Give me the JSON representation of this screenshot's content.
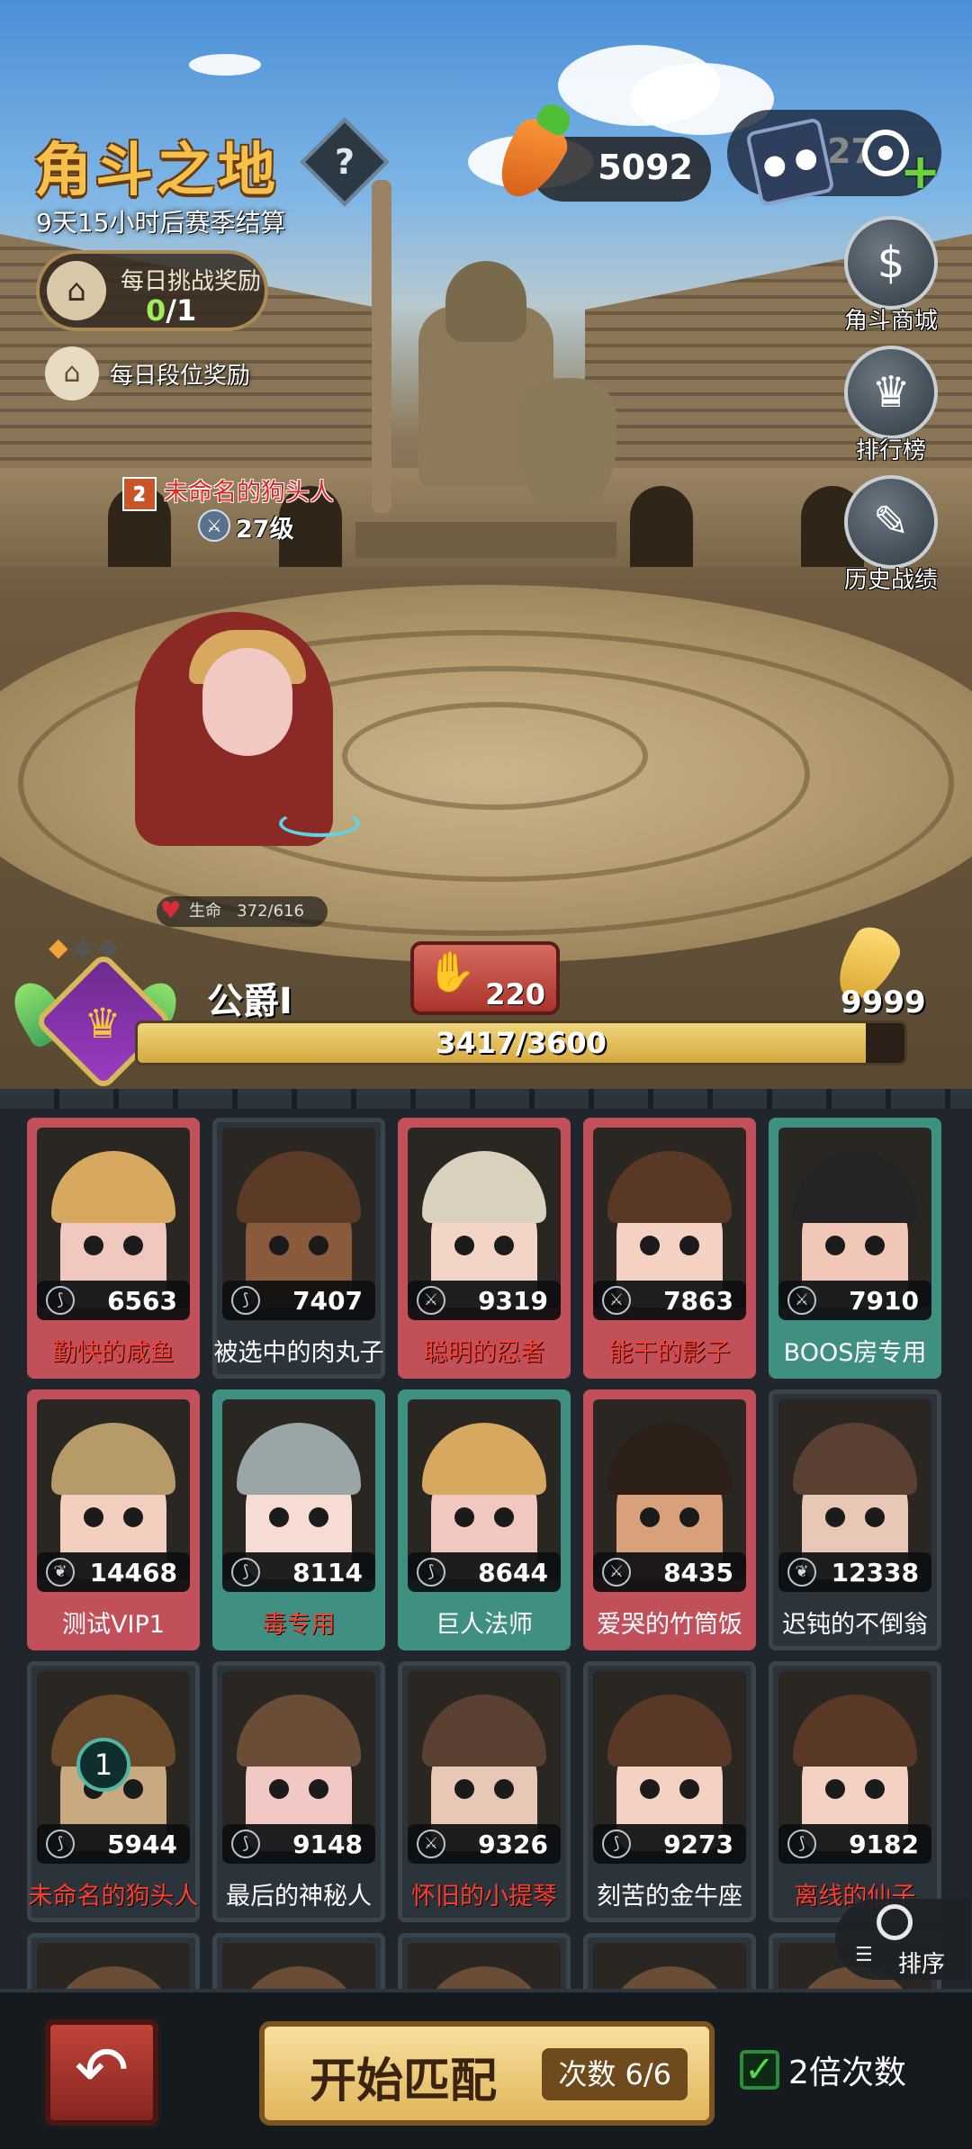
{
  "header": {
    "title": "角斗之地",
    "help": "?",
    "season_text": "9天15小时后赛季结算",
    "daily_challenge": {
      "label": "每日挑战奖励",
      "current": "0",
      "total": "/1"
    },
    "daily_rank_reward": "每日段位奖励"
  },
  "resources": {
    "carrot": "5092",
    "ticket": "27"
  },
  "side_buttons": [
    {
      "id": "shop",
      "label": "角斗商城",
      "icon": "money-bag-icon"
    },
    {
      "id": "rank",
      "label": "排行榜",
      "icon": "trophy-icon"
    },
    {
      "id": "history",
      "label": "历史战绩",
      "icon": "scroll-icon"
    }
  ],
  "opponent": {
    "name": "未命名的狗头人",
    "level": "27级"
  },
  "player": {
    "hp_label": "生命",
    "hp": "372/616",
    "rank_name": "公爵I",
    "score": "220",
    "gold_carrot": "9999",
    "xp": "3417/3600",
    "xp_fraction": 0.949
  },
  "roster": [
    {
      "name": "勤快的咸鱼",
      "power": "6563",
      "frame": "pink",
      "red": true,
      "skin": "#f0c8c0",
      "hair": "#d6a860",
      "icon": "claw"
    },
    {
      "name": "被选中的肉丸子",
      "power": "7407",
      "frame": "dark",
      "red": false,
      "skin": "#8a5a3c",
      "hair": "#5b3a26",
      "icon": "claw"
    },
    {
      "name": "聪明的忍者",
      "power": "9319",
      "frame": "pink",
      "red": true,
      "skin": "#f3d5c8",
      "hair": "#d9d1bd",
      "icon": "sword"
    },
    {
      "name": "能干的影子",
      "power": "7863",
      "frame": "pink",
      "red": true,
      "skin": "#f4d1c2",
      "hair": "#5a3826",
      "icon": "sword"
    },
    {
      "name": "BOOS房专用",
      "power": "7910",
      "frame": "teal",
      "red": false,
      "skin": "#f1c7b8",
      "hair": "#242424",
      "icon": "sword"
    },
    {
      "name": "测试VIP1",
      "power": "14468",
      "frame": "pink",
      "red": false,
      "skin": "#f3cfbf",
      "hair": "#b79a6a",
      "icon": "leaf"
    },
    {
      "name": "毒专用",
      "power": "8114",
      "frame": "teal",
      "red": true,
      "skin": "#f6dcd3",
      "hair": "#9aa6a6",
      "icon": "claw"
    },
    {
      "name": "巨人法师",
      "power": "8644",
      "frame": "teal",
      "red": false,
      "skin": "#f0c8c0",
      "hair": "#d6a860",
      "icon": "claw"
    },
    {
      "name": "爱哭的竹筒饭",
      "power": "8435",
      "frame": "pink",
      "red": false,
      "skin": "#d9a07c",
      "hair": "#2c1f18",
      "icon": "sword"
    },
    {
      "name": "迟钝的不倒翁",
      "power": "12338",
      "frame": "dark",
      "red": false,
      "skin": "#e8c7b6",
      "hair": "#5a4032",
      "icon": "leaf"
    },
    {
      "name": "未命名的狗头人",
      "power": "5944",
      "frame": "dark",
      "red": true,
      "skin": "#c8a980",
      "hair": "#6b4a2c",
      "icon": "claw",
      "badge": "1"
    },
    {
      "name": "最后的神秘人",
      "power": "9148",
      "frame": "dark",
      "red": false,
      "skin": "#f1c8c4",
      "hair": "#6a4d36",
      "icon": "claw"
    },
    {
      "name": "怀旧的小提琴",
      "power": "9326",
      "frame": "dark",
      "red": true,
      "skin": "#e8c7b6",
      "hair": "#5a4032",
      "icon": "sword"
    },
    {
      "name": "刻苦的金牛座",
      "power": "9273",
      "frame": "dark",
      "red": false,
      "skin": "#f4d1c2",
      "hair": "#5a3826",
      "icon": "claw"
    },
    {
      "name": "离线的仙子",
      "power": "9182",
      "frame": "dark",
      "red": true,
      "skin": "#f4d1c2",
      "hair": "#5a3826",
      "icon": "claw"
    }
  ],
  "sort_label": "排序",
  "bottom": {
    "start_label": "开始匹配",
    "count_label": "次数 6/6",
    "double_label": "2倍次数",
    "double_checked": true
  }
}
